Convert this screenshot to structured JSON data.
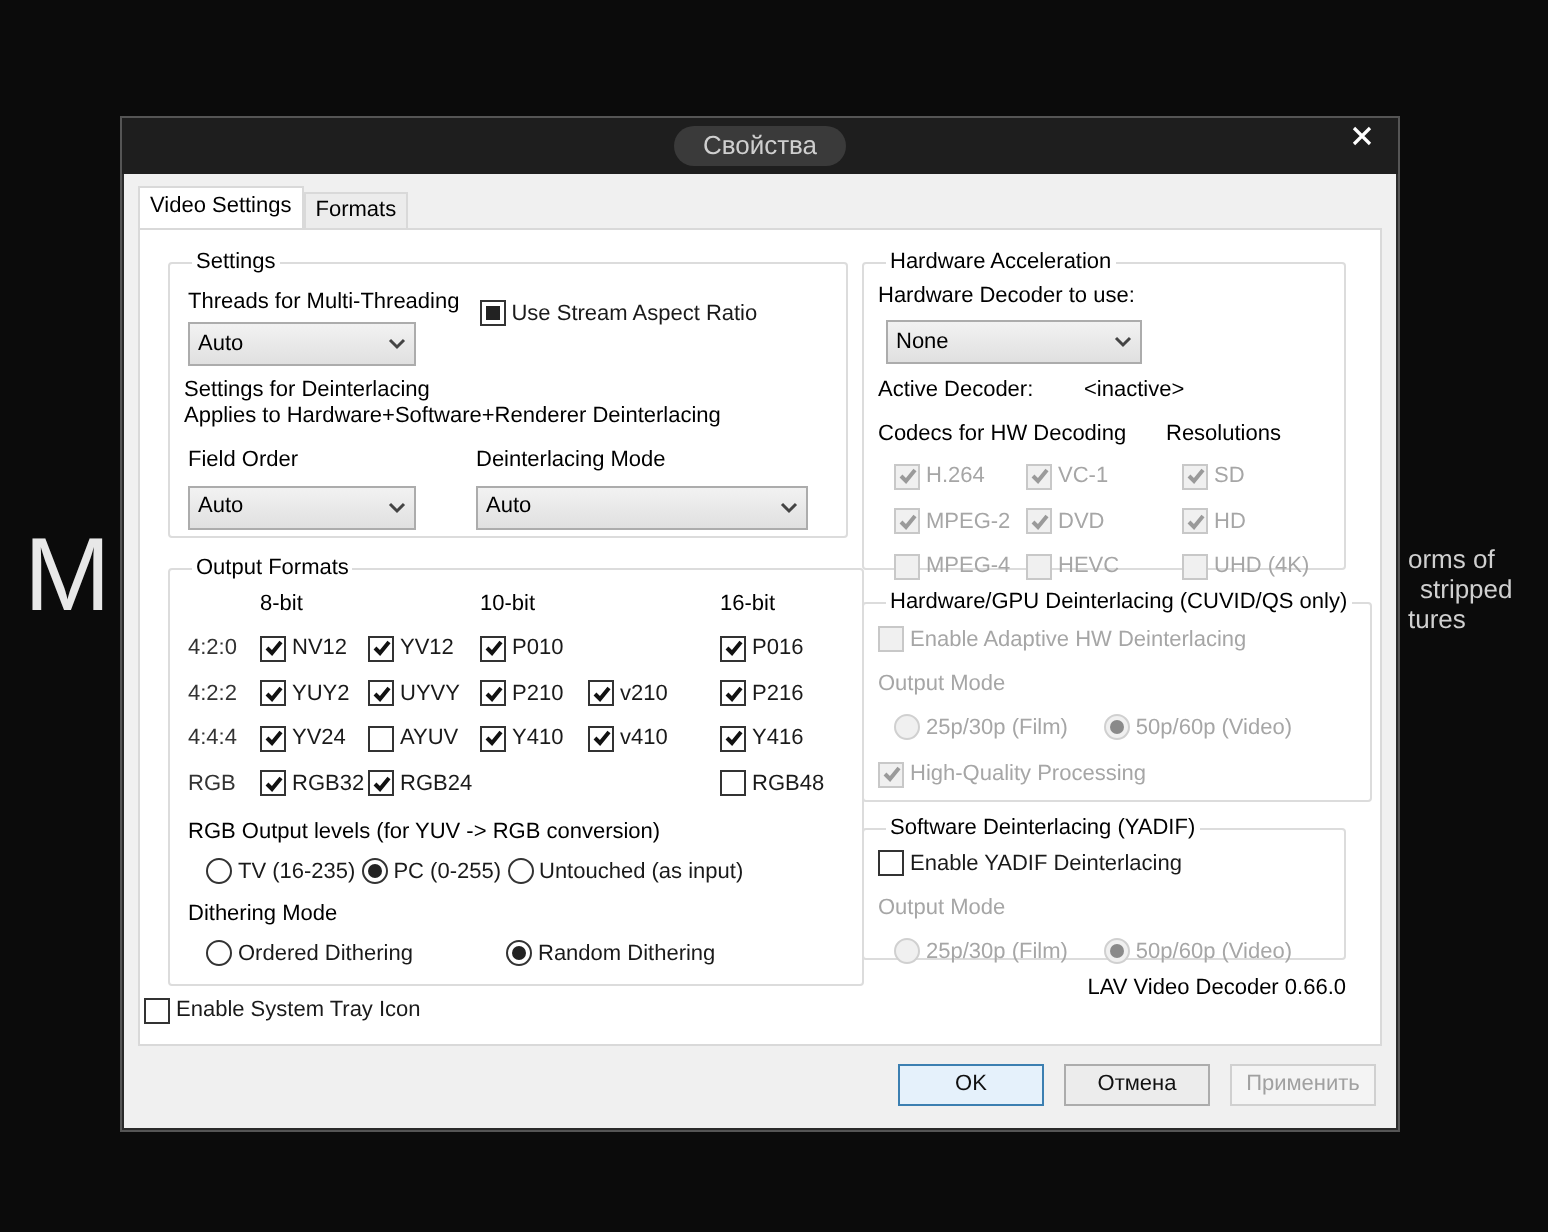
{
  "background_text": {
    "letter": "M",
    "lines": [
      "orms  of",
      "stripped",
      "tures"
    ]
  },
  "window": {
    "title": "Свойства"
  },
  "tabs": [
    {
      "label": "Video Settings",
      "selected": true
    },
    {
      "label": "Formats",
      "selected": false
    }
  ],
  "settings": {
    "title": "Settings",
    "threads_label": "Threads for Multi-Threading",
    "threads_value": "Auto",
    "stream_aspect": {
      "label": "Use Stream Aspect Ratio",
      "indeterminate": true
    },
    "deint_title": "Settings for Deinterlacing",
    "deint_note": "Applies to Hardware+Software+Renderer Deinterlacing",
    "field_order_label": "Field Order",
    "field_order_value": "Auto",
    "mode_label": "Deinterlacing Mode",
    "mode_value": "Auto"
  },
  "output_formats": {
    "title": "Output Formats",
    "headers": [
      "8-bit",
      "10-bit",
      "16-bit"
    ],
    "rows": [
      {
        "label": "4:2:0",
        "cells": [
          {
            "label": "NV12",
            "checked": true
          },
          {
            "label": "YV12",
            "checked": true
          },
          {
            "label": "P010",
            "checked": true
          },
          null,
          {
            "label": "P016",
            "checked": true
          }
        ]
      },
      {
        "label": "4:2:2",
        "cells": [
          {
            "label": "YUY2",
            "checked": true
          },
          {
            "label": "UYVY",
            "checked": true
          },
          {
            "label": "P210",
            "checked": true
          },
          {
            "label": "v210",
            "checked": true
          },
          {
            "label": "P216",
            "checked": true
          }
        ]
      },
      {
        "label": "4:4:4",
        "cells": [
          {
            "label": "YV24",
            "checked": true
          },
          {
            "label": "AYUV",
            "checked": false
          },
          {
            "label": "Y410",
            "checked": true
          },
          {
            "label": "v410",
            "checked": true
          },
          {
            "label": "Y416",
            "checked": true
          }
        ]
      },
      {
        "label": "RGB",
        "cells": [
          {
            "label": "RGB32",
            "checked": true
          },
          {
            "label": "RGB24",
            "checked": true
          },
          null,
          null,
          {
            "label": "RGB48",
            "checked": false
          }
        ]
      }
    ],
    "rgb_levels_label": "RGB Output levels (for YUV -> RGB conversion)",
    "rgb_levels": [
      {
        "label": "TV (16-235)",
        "selected": false
      },
      {
        "label": "PC (0-255)",
        "selected": true
      },
      {
        "label": "Untouched (as input)",
        "selected": false
      }
    ],
    "dithering_label": "Dithering Mode",
    "dithering": [
      {
        "label": "Ordered Dithering",
        "selected": false
      },
      {
        "label": "Random Dithering",
        "selected": true
      }
    ]
  },
  "system_tray": {
    "label": "Enable System Tray Icon",
    "checked": false
  },
  "hw_accel": {
    "title": "Hardware Acceleration",
    "decoder_label": "Hardware Decoder to use:",
    "decoder_value": "None",
    "active_label": "Active Decoder:",
    "active_value": "<inactive>",
    "codecs_label": "Codecs for HW Decoding",
    "resolutions_label": "Resolutions",
    "codecs": [
      {
        "label": "H.264",
        "checked": true,
        "disabled": true
      },
      {
        "label": "VC-1",
        "checked": true,
        "disabled": true
      },
      {
        "label": "MPEG-2",
        "checked": true,
        "disabled": true
      },
      {
        "label": "DVD",
        "checked": true,
        "disabled": true
      },
      {
        "label": "MPEG-4",
        "checked": false,
        "disabled": true
      },
      {
        "label": "HEVC",
        "checked": false,
        "disabled": true
      }
    ],
    "resolutions": [
      {
        "label": "SD",
        "checked": true,
        "disabled": true
      },
      {
        "label": "HD",
        "checked": true,
        "disabled": true
      },
      {
        "label": "UHD (4K)",
        "checked": false,
        "disabled": true
      }
    ]
  },
  "hw_deint": {
    "title": "Hardware/GPU Deinterlacing (CUVID/QS only)",
    "enable": {
      "label": "Enable Adaptive HW Deinterlacing",
      "checked": false,
      "disabled": true
    },
    "output_mode_label": "Output Mode",
    "modes": [
      {
        "label": "25p/30p (Film)",
        "selected": false,
        "disabled": true
      },
      {
        "label": "50p/60p (Video)",
        "selected": true,
        "disabled": true
      }
    ],
    "hq": {
      "label": "High-Quality Processing",
      "checked": true,
      "disabled": true
    }
  },
  "sw_deint": {
    "title": "Software Deinterlacing (YADIF)",
    "enable": {
      "label": "Enable YADIF Deinterlacing",
      "checked": false,
      "disabled": false
    },
    "output_mode_label": "Output Mode",
    "modes": [
      {
        "label": "25p/30p (Film)",
        "selected": false,
        "disabled": true
      },
      {
        "label": "50p/60p (Video)",
        "selected": true,
        "disabled": true
      }
    ]
  },
  "version": "LAV Video Decoder 0.66.0",
  "buttons": [
    {
      "label": "OK",
      "default": true,
      "disabled": false
    },
    {
      "label": "Отмена",
      "default": false,
      "disabled": false
    },
    {
      "label": "Применить",
      "default": false,
      "disabled": true
    }
  ]
}
